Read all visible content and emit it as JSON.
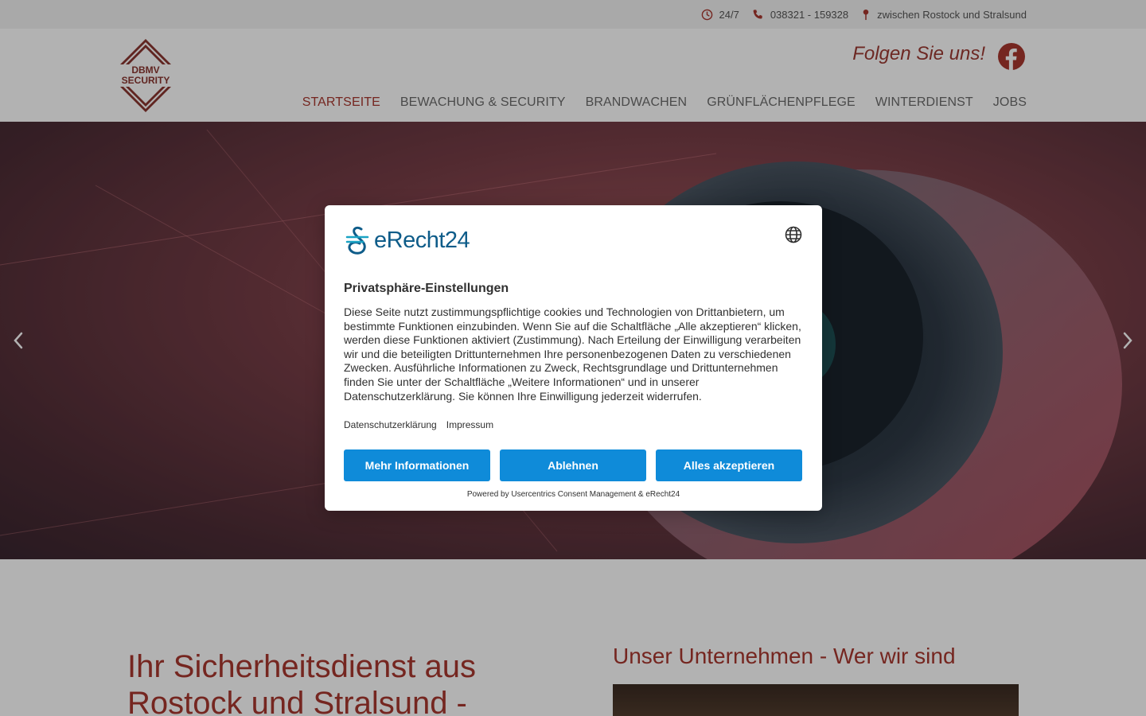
{
  "topbar": {
    "hours": "24/7",
    "phone": "038321 - 159328",
    "location": "zwischen Rostock und Stralsund"
  },
  "header": {
    "logo_line1": "DBMV",
    "logo_line2": "SECURITY",
    "follow_text": "Folgen Sie uns!",
    "social_icon": "facebook-icon"
  },
  "nav": {
    "items": [
      {
        "label": "STARTSEITE",
        "active": true
      },
      {
        "label": "BEWACHUNG & SECURITY"
      },
      {
        "label": "BRANDWACHEN"
      },
      {
        "label": "GRÜNFLÄCHENPFLEGE"
      },
      {
        "label": "WINTERDIENST"
      },
      {
        "label": "JOBS"
      }
    ]
  },
  "main": {
    "title": "Ihr Sicherheitsdienst aus Rostock und Stralsund -",
    "about_title": "Unser Unternehmen - Wer wir sind"
  },
  "consent": {
    "brand": "eRecht24",
    "title": "Privatsphäre-Einstellungen",
    "body": "Diese Seite nutzt zustimmungspflichtige cookies und Technologien von Drittanbietern, um bestimmte Funktionen einzubinden. Wenn Sie auf die Schaltfläche „Alle akzeptieren“ klicken, werden diese Funktionen aktiviert (Zustimmung). Nach Erteilung der Einwilligung verarbeiten wir und die beteiligten Drittunternehmen Ihre personenbezogenen Daten zu verschiedenen Zwecken. Ausführliche Informationen zu Zweck, Rechtsgrundlage und Drittunternehmen finden Sie unter der Schaltfläche „Weitere Informationen“ und in unserer Datenschutzerklärung. Sie können Ihre Einwilligung jederzeit widerrufen.",
    "link_privacy": "Datenschutzerklärung",
    "link_imprint": "Impressum",
    "btn_more": "Mehr Informationen",
    "btn_deny": "Ablehnen",
    "btn_accept": "Alles akzeptieren",
    "powered_by": "Powered by Usercentrics Consent Management & eRecht24"
  },
  "colors": {
    "accent": "#a8372f",
    "button": "#0f8bd9",
    "brand": "#0e5c89"
  }
}
